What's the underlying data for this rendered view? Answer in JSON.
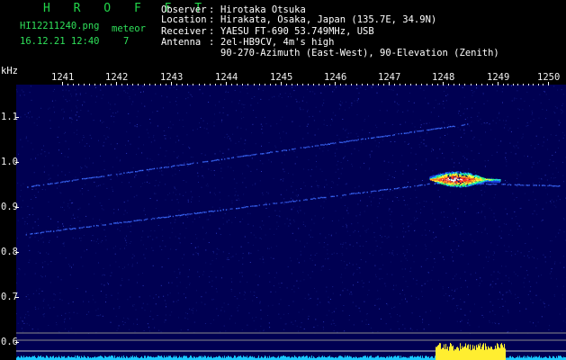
{
  "header": {
    "brand": "H R O F F T",
    "filename": "HI12211240.png",
    "meteor_label": "meteor",
    "datetime": "16.12.21 12:40",
    "meteor_count": "7"
  },
  "station": {
    "observer_label": "Observer",
    "observer_value": "Hirotaka Otsuka",
    "location_label": "Location",
    "location_value": "Hirakata, Osaka, Japan (135.7E, 34.9N)",
    "receiver_label": "Receiver",
    "receiver_value": "YAESU FT-690 53.749MHz, USB",
    "antenna_label": "Antenna",
    "antenna_value": "2el-HB9CV, 4m's high",
    "antenna_value_2": "90-270-Azimuth (East-West), 90-Elevation (Zenith)",
    "separator": ":"
  },
  "colors": {
    "background": "#000000",
    "plot_background": "#000052",
    "brand_green": "#22d64a",
    "trace_blue": "#3b6cff",
    "hot_yellow": "#ffff40",
    "baseline_cyan": "#19c8ff",
    "power_yellow": "#ffee30"
  },
  "chart_data": {
    "type": "heatmap",
    "ylabel": "kHz",
    "x_ticks": [
      "1241",
      "1242",
      "1243",
      "1244",
      "1245",
      "1246",
      "1247",
      "1248",
      "1249",
      "1250"
    ],
    "y_ticks": [
      "1.1",
      "1.0",
      "0.9",
      "0.8",
      "0.7",
      "0.6"
    ],
    "xlim": [
      1240.3,
      1250.2
    ],
    "ylim": [
      0.58,
      1.165
    ],
    "traces": [
      {
        "name": "",
        "points": [
          [
            1240.3,
            0.945
          ],
          [
            1248.5,
            1.085
          ]
        ]
      },
      {
        "name": "",
        "points": [
          [
            1240.3,
            0.84
          ],
          [
            1248.0,
            0.955
          ],
          [
            1250.2,
            0.948
          ]
        ]
      }
    ],
    "echo": {
      "x_range": [
        1247.8,
        1249.1
      ],
      "y_center": 0.962
    },
    "power_burst": {
      "x_range": [
        1247.9,
        1249.2
      ]
    }
  }
}
